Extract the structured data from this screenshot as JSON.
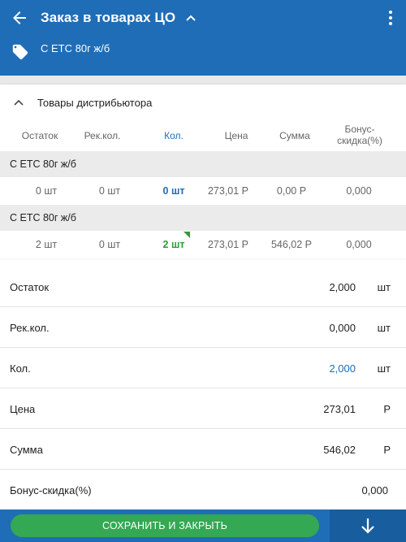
{
  "header": {
    "title": "Заказ в товарах ЦО",
    "subtitle": "С ЕТС 80г ж/б",
    "back_icon": "arrow-left-icon",
    "menu_icon": "more-vertical-icon",
    "tag_icon": "tag-icon"
  },
  "section": {
    "title": "Товары дистрибьютора"
  },
  "columns": {
    "stock": "Остаток",
    "rec_qty": "Рек.кол.",
    "qty": "Кол.",
    "price": "Цена",
    "sum": "Сумма",
    "bonus_line1": "Бонус-",
    "bonus_line2": "скидка(%)"
  },
  "rows": [
    {
      "group": "С ЕТС 80г ж/б",
      "stock": "0 шт",
      "rec_qty": "0 шт",
      "qty": "0 шт",
      "price": "273,01 Р",
      "sum": "0,00 Р",
      "bonus": "0,000"
    },
    {
      "group": "С ЕТС 80г ж/б",
      "stock": "2 шт",
      "rec_qty": "0 шт",
      "qty": "2 шт",
      "price": "273,01 Р",
      "sum": "546,02 Р",
      "bonus": "0,000"
    }
  ],
  "details": {
    "stock": {
      "label": "Остаток",
      "value": "2,000",
      "unit": "шт"
    },
    "rec_qty": {
      "label": "Рек.кол.",
      "value": "0,000",
      "unit": "шт"
    },
    "qty": {
      "label": "Кол.",
      "value": "2,000",
      "unit": "шт"
    },
    "price": {
      "label": "Цена",
      "value": "273,01",
      "unit": "Р"
    },
    "sum": {
      "label": "Сумма",
      "value": "546,02",
      "unit": "Р"
    },
    "bonus": {
      "label": "Бонус-скидка(%)",
      "value": "0,000"
    }
  },
  "footer": {
    "save_label": "СОХРАНИТЬ И ЗАКРЫТЬ",
    "down_icon": "arrow-down-icon"
  },
  "colors": {
    "primary": "#1f6db6",
    "accent_green": "#34a853",
    "qty_active": "#1f6db6",
    "qty_changed": "#2e9d3a"
  }
}
